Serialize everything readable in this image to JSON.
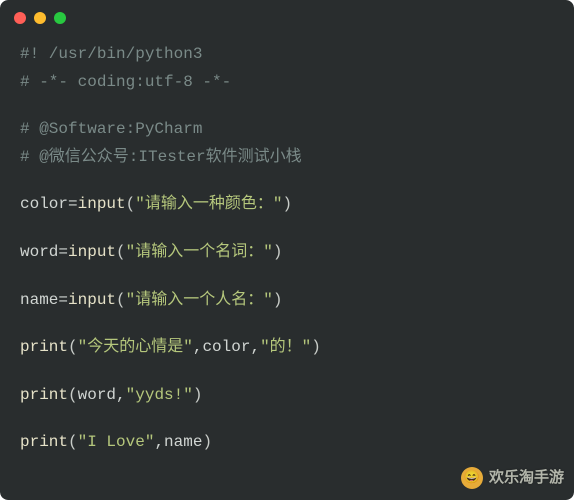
{
  "window": {
    "traffic": {
      "close": "red",
      "minimize": "yellow",
      "zoom": "green"
    }
  },
  "code": {
    "l1": {
      "comment": "#! /usr/bin/python3"
    },
    "l2": {
      "comment": "# -*- coding:utf-8 -*-"
    },
    "l3": {
      "hash": "# ",
      "at": "@Software",
      "rest": ":PyCharm"
    },
    "l4": {
      "comment": "# @微信公众号:ITester软件测试小栈"
    },
    "l5": {
      "pre": "color=",
      "fn": "input",
      "open": "(",
      "str": "\"请输入一种颜色：\"",
      "close": ")"
    },
    "l6": {
      "pre": "word=",
      "fn": "input",
      "open": "(",
      "str": "\"请输入一个名词：\"",
      "close": ")"
    },
    "l7": {
      "pre": "name=",
      "fn": "input",
      "open": "(",
      "str": "\"请输入一个人名：\"",
      "close": ")"
    },
    "l8": {
      "fn": "print",
      "open": "(",
      "s1": "\"今天的心情是\"",
      "c1": ",color,",
      "s2": "\"的！\"",
      "close": ")"
    },
    "l9": {
      "fn": "print",
      "open": "(",
      "pre": "word,",
      "s1": "\"yyds!\"",
      "close": ")"
    },
    "l10": {
      "fn": "print",
      "open": "(",
      "s1": "\"I Love\"",
      "post": ",name",
      "close": ")"
    }
  },
  "watermark": {
    "emoji": "😄",
    "text": "欢乐淘手游"
  }
}
